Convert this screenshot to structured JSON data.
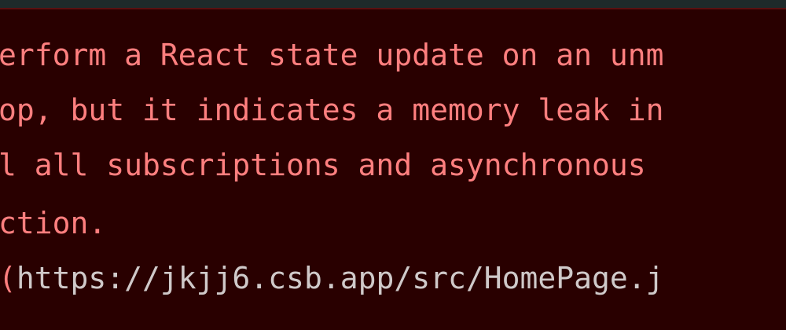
{
  "console": {
    "error_lines": [
      "erform a React state update on an unm",
      "op, but it indicates a memory leak in",
      "l all subscriptions and asynchronous ",
      "ction."
    ],
    "source": {
      "paren": "(",
      "url": "https://jkjj6.csb.app/src/HomePage.j"
    }
  },
  "colors": {
    "background": "#290000",
    "error_text": "#ff7f7f",
    "link_text": "#cfc9c9"
  }
}
